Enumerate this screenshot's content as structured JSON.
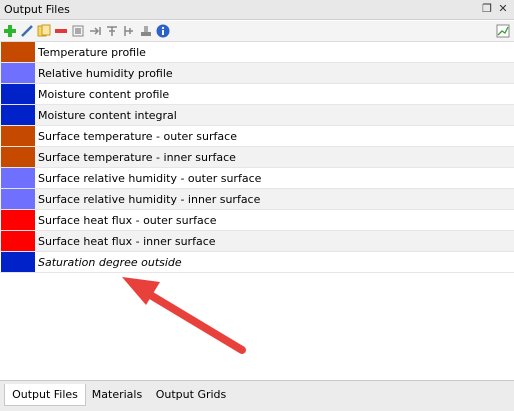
{
  "panel": {
    "title": "Output Files",
    "restore_icon": "restore-icon",
    "close_icon": "close-icon"
  },
  "toolbar": {
    "icons": [
      "add-icon",
      "edit-icon",
      "copy-icon",
      "remove-icon",
      "export-icon",
      "move-right-icon",
      "filter-icon",
      "split-icon",
      "stamp-icon",
      "info-icon",
      "chart-icon"
    ]
  },
  "outputs": [
    {
      "label": "Temperature profile",
      "color": "#c54a00"
    },
    {
      "label": "Relative humidity profile",
      "color": "#7070ff"
    },
    {
      "label": "Moisture content profile",
      "color": "#0022c8"
    },
    {
      "label": "Moisture content integral",
      "color": "#0022c8"
    },
    {
      "label": "Surface temperature - outer surface",
      "color": "#c54a00"
    },
    {
      "label": "Surface temperature - inner surface",
      "color": "#c54a00"
    },
    {
      "label": "Surface relative humidity - outer surface",
      "color": "#7070ff"
    },
    {
      "label": "Surface relative humidity - inner surface",
      "color": "#7070ff"
    },
    {
      "label": "Surface heat flux - outer surface",
      "color": "#ff0000"
    },
    {
      "label": "Surface heat flux - inner surface",
      "color": "#ff0000"
    },
    {
      "label": "Saturation degree outside",
      "color": "#0022c8"
    }
  ],
  "annotation": {
    "arrow_color": "#e8413c"
  },
  "tabs": [
    {
      "label": "Output Files",
      "active": true
    },
    {
      "label": "Materials",
      "active": false
    },
    {
      "label": "Output Grids",
      "active": false
    }
  ]
}
